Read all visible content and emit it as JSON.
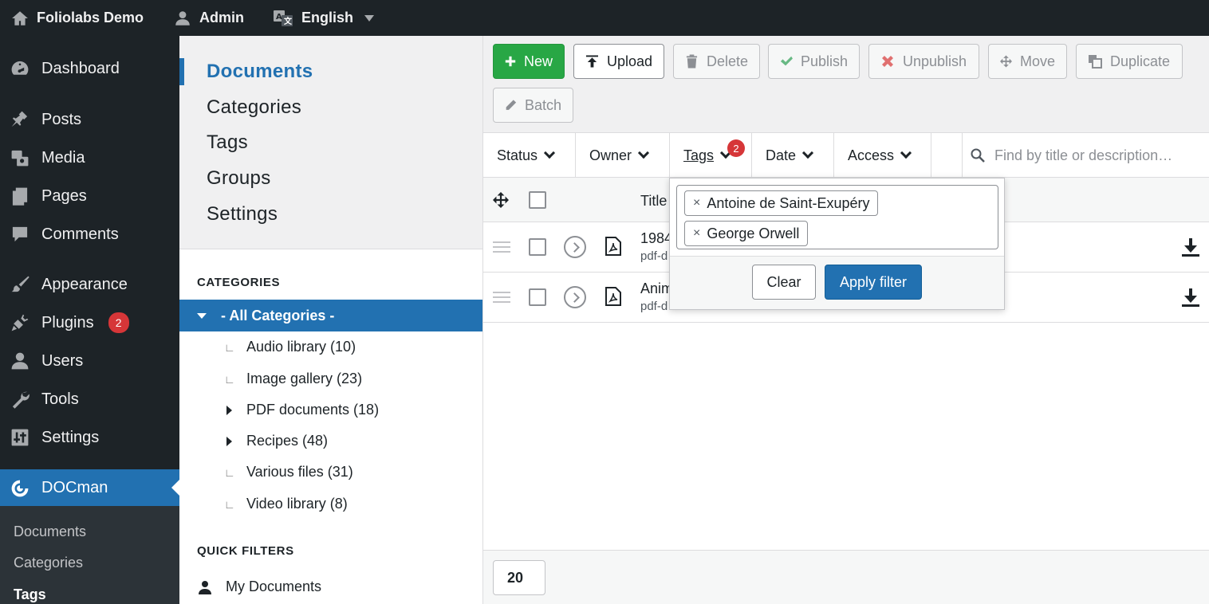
{
  "adminbar": {
    "site_name": "Foliolabs Demo",
    "user": "Admin",
    "language": "English"
  },
  "wp_menu": {
    "items": [
      {
        "label": "Dashboard",
        "icon": "dashboard-icon"
      },
      {
        "label": "Posts",
        "icon": "pin-icon"
      },
      {
        "label": "Media",
        "icon": "media-icon"
      },
      {
        "label": "Pages",
        "icon": "pages-icon"
      },
      {
        "label": "Comments",
        "icon": "comments-icon"
      },
      {
        "label": "Appearance",
        "icon": "brush-icon"
      },
      {
        "label": "Plugins",
        "icon": "plugin-icon",
        "badge": "2"
      },
      {
        "label": "Users",
        "icon": "user-icon"
      },
      {
        "label": "Tools",
        "icon": "wrench-icon"
      },
      {
        "label": "Settings",
        "icon": "settings-icon"
      },
      {
        "label": "DOCman",
        "icon": "docman-icon"
      }
    ],
    "submenu": [
      "Documents",
      "Categories",
      "Tags"
    ]
  },
  "docman_nav": {
    "items": [
      "Documents",
      "Categories",
      "Tags",
      "Groups",
      "Settings"
    ]
  },
  "categories": {
    "heading": "CATEGORIES",
    "all": "- All Categories -",
    "items": [
      {
        "label": "Audio library (10)"
      },
      {
        "label": "Image gallery (23)"
      },
      {
        "label": "PDF documents (18)"
      },
      {
        "label": "Recipes (48)"
      },
      {
        "label": "Various files (31)"
      },
      {
        "label": "Video library (8)"
      }
    ]
  },
  "quick_filters": {
    "heading": "QUICK FILTERS",
    "items": [
      "My Documents"
    ]
  },
  "toolbar": {
    "new": "New",
    "upload": "Upload",
    "delete": "Delete",
    "publish": "Publish",
    "unpublish": "Unpublish",
    "move": "Move",
    "duplicate": "Duplicate",
    "batch": "Batch"
  },
  "filters": {
    "status": "Status",
    "owner": "Owner",
    "tags": "Tags",
    "tags_count": "2",
    "date": "Date",
    "access": "Access",
    "search_placeholder": "Find by title or description…"
  },
  "table": {
    "title_header": "Title",
    "rows": [
      {
        "title": "1984",
        "sub": "pdf-d"
      },
      {
        "title": "Anim",
        "sub": "pdf-d"
      }
    ]
  },
  "footer": {
    "limit": "20"
  },
  "tags_popover": {
    "selected": [
      "Antoine de Saint-Exupéry",
      "George Orwell"
    ],
    "remove_symbol": "×",
    "clear": "Clear",
    "apply": "Apply filter"
  },
  "colors": {
    "accent": "#2271b1",
    "admin_dark": "#1d2327",
    "new_button": "#28a745",
    "badge": "#d63638"
  }
}
